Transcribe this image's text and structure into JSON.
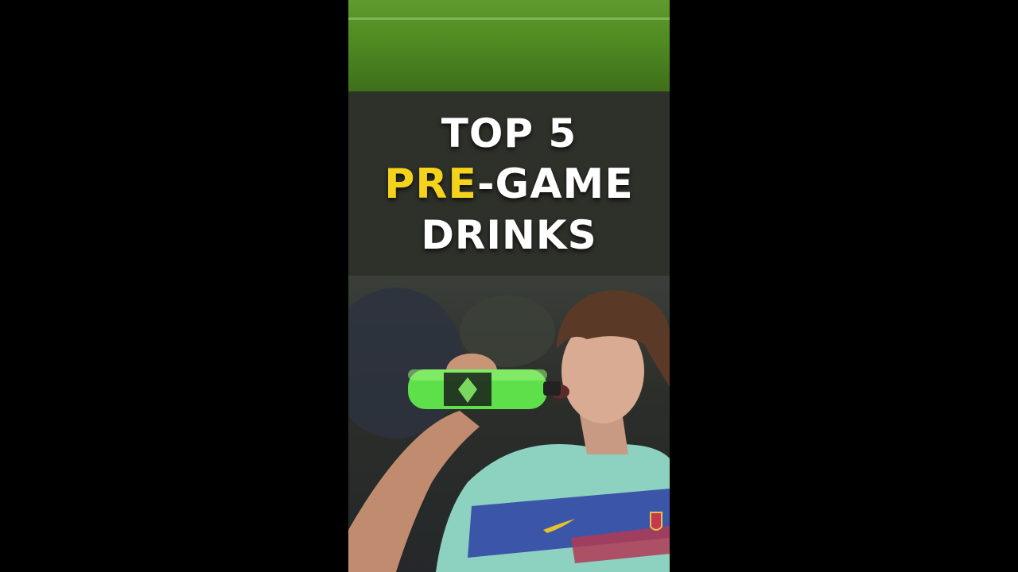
{
  "title": {
    "line1": "TOP 5",
    "line2_accent": "PRE",
    "line2_rest": "-GAME",
    "line3": "DRINKS"
  },
  "colors": {
    "accent": "#f5d31c",
    "text": "#ffffff",
    "banner": "#2f312b",
    "pitch": "#4f8a22",
    "bottle": "#5ee04a"
  },
  "icons": [
    "bottle-icon",
    "crest-icon",
    "swoosh-icon"
  ]
}
